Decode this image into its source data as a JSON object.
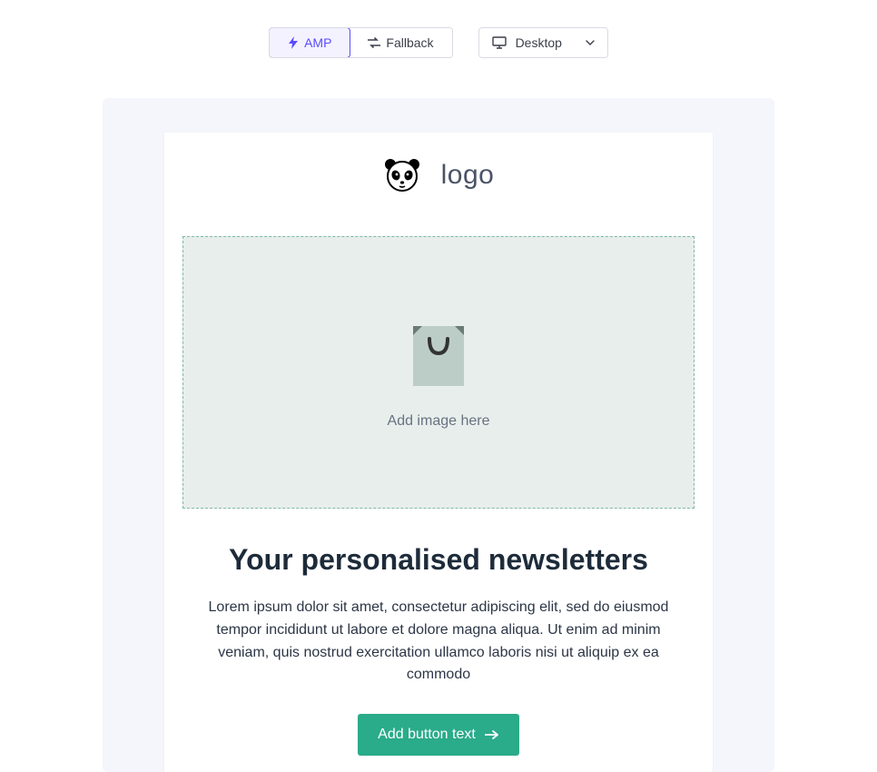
{
  "toolbar": {
    "amp_label": "AMP",
    "fallback_label": "Fallback",
    "device_selected": "Desktop"
  },
  "email": {
    "logo_text": "logo",
    "image_placeholder": "Add image here",
    "headline": "Your personalised newsletters",
    "body": "Lorem ipsum dolor sit amet, consectetur adipiscing elit, sed do eiusmod tempor incididunt ut labore et dolore magna aliqua. Ut enim ad minim veniam, quis nostrud exercitation ullamco laboris nisi ut aliquip ex ea commodo",
    "cta_label": "Add button text"
  }
}
